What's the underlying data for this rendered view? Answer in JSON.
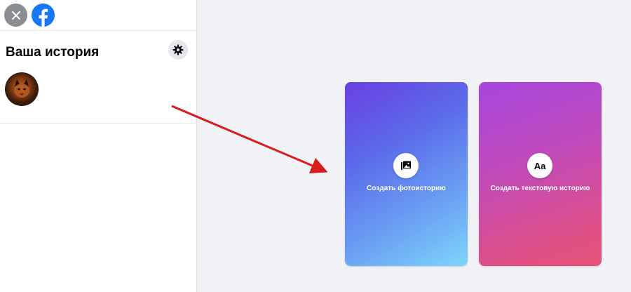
{
  "sidebar": {
    "close_icon": "close-icon",
    "logo_icon": "facebook-logo-icon",
    "title": "Ваша история",
    "settings_icon": "gear-icon"
  },
  "cards": {
    "photo": {
      "label": "Создать фотоисторию",
      "icon": "photo-icon"
    },
    "text": {
      "label": "Создать текстовую историю",
      "icon_text": "Aa"
    }
  },
  "annotation": {
    "arrow_color": "#d91c1c"
  },
  "colors": {
    "facebook_blue": "#1877f2",
    "page_background": "#f0f2f5"
  }
}
